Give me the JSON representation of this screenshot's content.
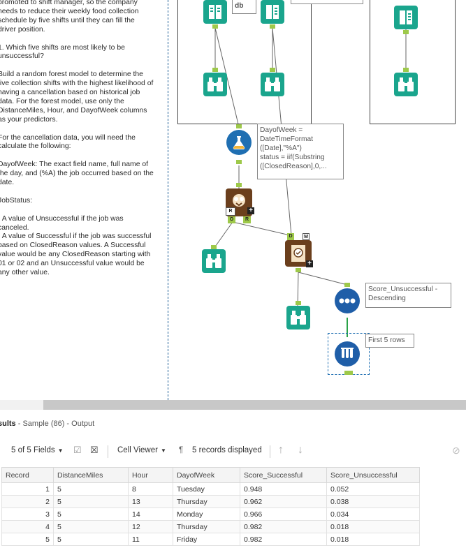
{
  "instructions": {
    "lines": [
      "promoted to shift manager, so the company",
      "needs to reduce their weekly food collection",
      "schedule by five shifts until they can fill the",
      "driver position.",
      "",
      "1. Which five shifts are most likely to be",
      "unsuccessful?",
      "",
      "Build a random forest model to determine the",
      "five collection shifts with the highest likelihood of",
      "having a cancellation based on historical job",
      "data. For the forest model, use only the",
      "DistanceMiles, Hour, and DayofWeek columns",
      "as your predictors.",
      "",
      "For the cancellation data, you will need the",
      "calculate the following:",
      "",
      "DayofWeek: The exact field name, full name of",
      "the day, and (%A) the job occurred based on the",
      "date.",
      "",
      "JobStatus:",
      "",
      "- A value of Unsuccessful if the job was",
      "canceled.",
      "- A value of Successful if the job was successful",
      "based on ClosedReason values. A Successful",
      "value would be any ClosedReason starting with",
      "01 or 02 and an Unsuccessful value would be",
      "any other value."
    ]
  },
  "workflow": {
    "db_label": "db",
    "formula_annotation": [
      "DayofWeek =",
      "DateTimeFormat",
      "([Date],\"%A\")",
      "status = iif(Substring",
      "([ClosedReason],0,..."
    ],
    "sort_annotation": [
      "Score_Unsuccessful -",
      "Descending"
    ],
    "sample_annotation": "First 5 rows",
    "forest_anchors": {
      "left": "R",
      "out_o": "O",
      "out_r": "R"
    },
    "score_anchors": {
      "d": "D",
      "m": "M"
    }
  },
  "results": {
    "title_bold": "sults",
    "title_rest": " - Sample (86) - Output",
    "fields_dropdown": "5 of 5 Fields",
    "cell_viewer": "Cell Viewer",
    "records_displayed": "5 records displayed"
  },
  "table": {
    "columns": [
      "Record",
      "DistanceMiles",
      "Hour",
      "DayofWeek",
      "Score_Successful",
      "Score_Unsuccessful"
    ],
    "rows": [
      [
        "1",
        "5",
        "8",
        "Tuesday",
        "0.948",
        "0.052"
      ],
      [
        "2",
        "5",
        "13",
        "Thursday",
        "0.962",
        "0.038"
      ],
      [
        "3",
        "5",
        "14",
        "Monday",
        "0.966",
        "0.034"
      ],
      [
        "4",
        "5",
        "12",
        "Thursday",
        "0.982",
        "0.018"
      ],
      [
        "5",
        "5",
        "11",
        "Friday",
        "0.982",
        "0.018"
      ]
    ]
  },
  "colors": {
    "browse_tool": "#1aa58d",
    "formula_tool": "#1f6fb2",
    "predictive_tool": "#6b3f1d",
    "sort_tool": "#1f5ea8",
    "anchor": "#9ec94a"
  },
  "icons": [
    "input-book-icon",
    "browse-binoculars-icon",
    "formula-flask-icon",
    "forest-model-icon",
    "score-icon",
    "sort-icon",
    "sample-icon",
    "dropdown-icon",
    "checkbox-icon",
    "close-box-icon",
    "pilcrow-icon",
    "arrow-up-icon",
    "arrow-down-icon",
    "blocked-icon"
  ]
}
